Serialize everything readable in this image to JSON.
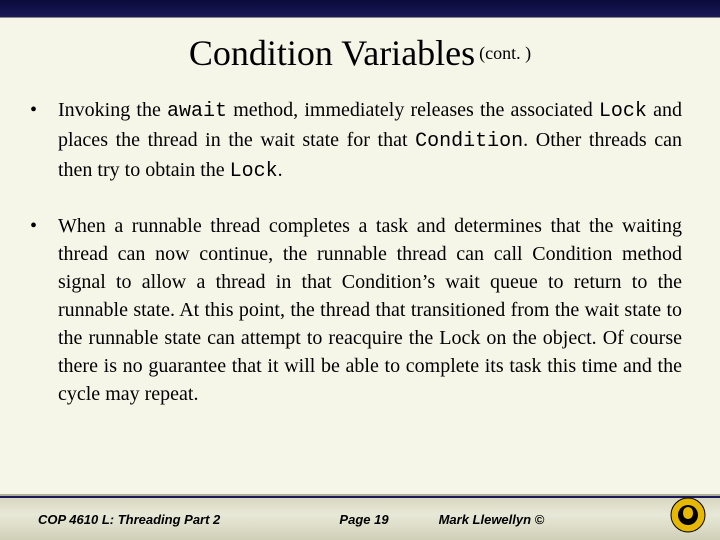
{
  "header": {
    "title": "Condition Variables",
    "cont": "(cont. )"
  },
  "bullets": [
    {
      "pre": "Invoking the ",
      "code1": "await",
      "mid1": " method, immediately releases the associated ",
      "code2": "Lock",
      "mid2": " and places the thread in the wait state for that ",
      "code3": "Condition",
      "mid3": ". Other threads can then try to obtain the ",
      "code4": "Lock",
      "post": "."
    },
    {
      "text": "When a runnable thread completes a task and determines that the waiting thread can now continue, the runnable thread can call Condition method signal to allow a thread in that Condition’s wait queue to return to the runnable state. At this point, the thread that transitioned from the wait state to the runnable state can attempt to reacquire the Lock on the object. Of course there is no guarantee that it will be able to complete its task this time and the cycle may repeat."
    }
  ],
  "footer": {
    "left": "COP 4610 L: Threading Part 2",
    "center": "Page 19",
    "right": "Mark Llewellyn ©"
  }
}
